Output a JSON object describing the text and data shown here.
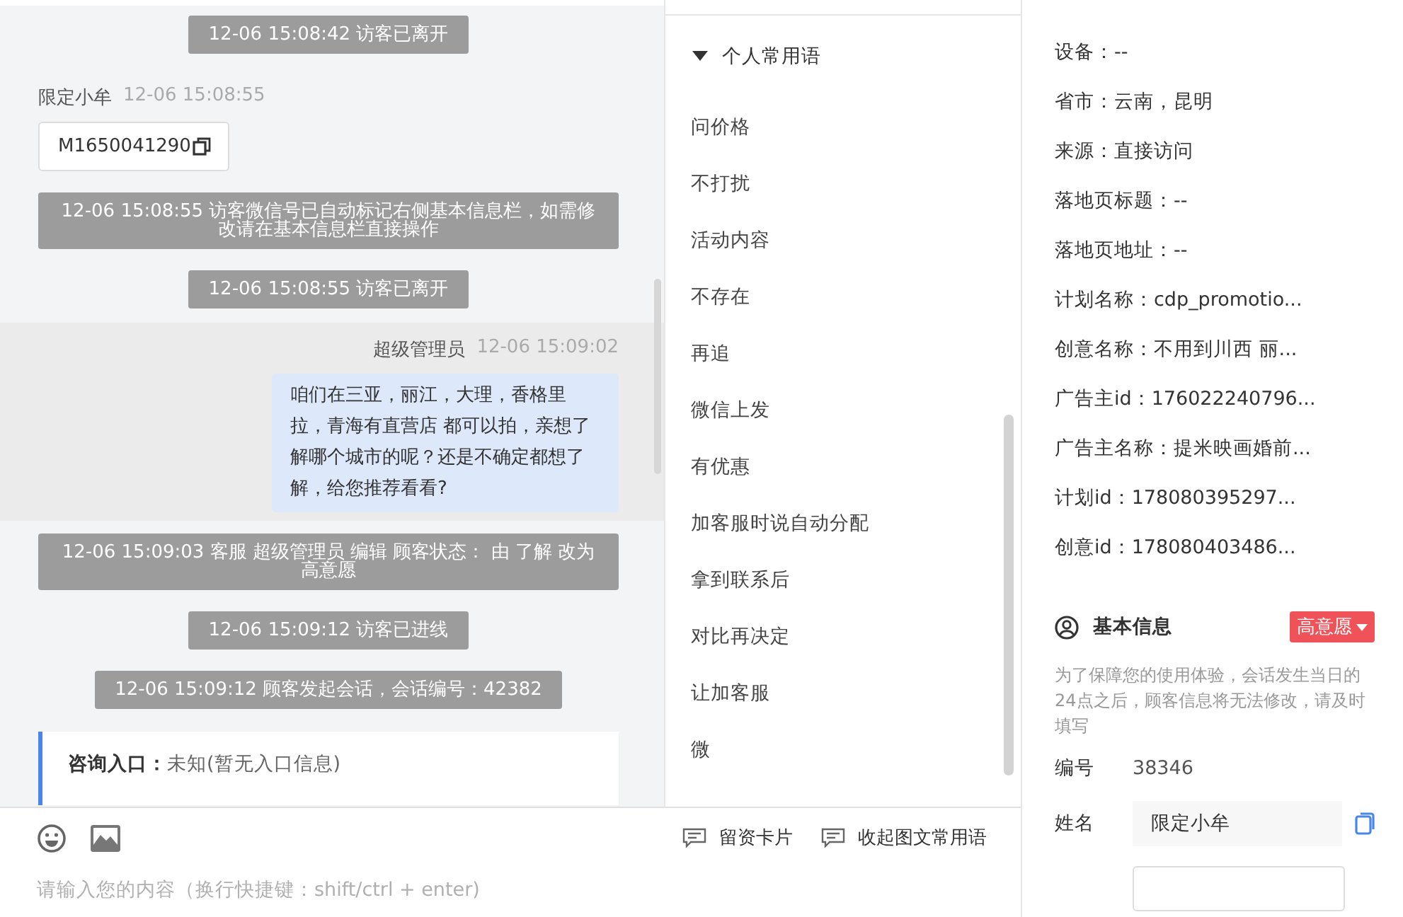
{
  "chat": {
    "messages": [
      {
        "kind": "system",
        "text": "12-06 15:08:42 访客已离开"
      },
      {
        "kind": "visitor",
        "sender": "限定小牟",
        "time": "12-06 15:08:55",
        "card": "M1650041290"
      },
      {
        "kind": "system",
        "text": "12-06 15:08:55 访客微信号已自动标记右侧基本信息栏，如需修改请在基本信息栏直接操作"
      },
      {
        "kind": "system",
        "text": "12-06 15:08:55 访客已离开"
      },
      {
        "kind": "agent",
        "sender": "超级管理员",
        "time": "12-06 15:09:02",
        "text": "咱们在三亚，丽江，大理，香格里拉，青海有直营店 都可以拍，亲想了解哪个城市的呢？还是不确定都想了解，给您推荐看看?"
      },
      {
        "kind": "system",
        "text": "12-06 15:09:03 客服 超级管理员 编辑 顾客状态： 由 了解 改为高意愿"
      },
      {
        "kind": "system",
        "text": "12-06 15:09:12 访客已进线"
      },
      {
        "kind": "system",
        "text": "12-06 15:09:12 顾客发起会话，会话编号：42382"
      },
      {
        "kind": "consult",
        "label": "咨询入口：",
        "value": "未知(暂无入口信息)"
      }
    ]
  },
  "composer": {
    "placeholder": "请输入您的内容（换行快捷键：shift/ctrl + enter)"
  },
  "phrases": {
    "group": "个人常用语",
    "expanded": true,
    "items": [
      "问价格",
      "不打扰",
      "活动内容",
      "不存在",
      "再追",
      "微信上发",
      "有优惠",
      "加客服时说自动分配",
      "拿到联系后",
      "对比再决定",
      "让加客服",
      "微"
    ]
  },
  "actions": [
    "留资卡片",
    "收起图文常用语"
  ],
  "source_info": {
    "fields": [
      "设备：--",
      "省市：云南，昆明",
      "来源：直接访问",
      "落地页标题：--",
      "落地页地址：--",
      "计划名称：cdp_promotio...",
      "创意名称：不用到川西 丽...",
      "广告主id：176022240796...",
      "广告主名称：提米映画婚前...",
      "计划id：178080395297...",
      "创意id：178080403486..."
    ]
  },
  "basic_info": {
    "title": "基本信息",
    "status": "高意愿",
    "note": "为了保障您的使用体验，会话发生当日的24点之后，顾客信息将无法修改，请及时填写",
    "number_label": "编号",
    "number": "38346",
    "name_label": "姓名",
    "name": "限定小牟"
  }
}
